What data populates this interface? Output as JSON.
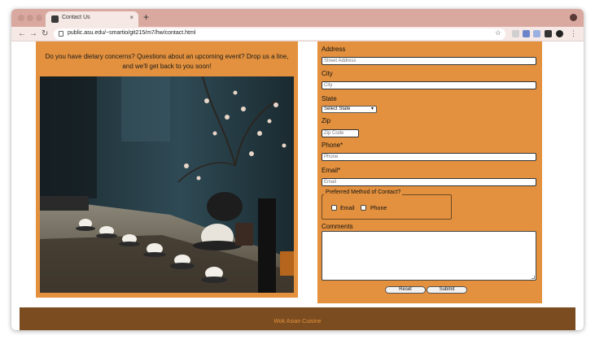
{
  "browser": {
    "tab_title": "Contact Us",
    "new_tab_symbol": "+",
    "tab_close_symbol": "×",
    "url": "public.asu.edu/~smartio/git215/m7/hw/contact.html",
    "nav_back": "←",
    "nav_forward": "→",
    "nav_reload": "↻",
    "bookmark_icon": "star-icon"
  },
  "page": {
    "intro_text": "Do you have dietary concerns? Questions about an upcoming event? Drop us a line, and we'll get back to you soon!",
    "photo_alt": "tea set"
  },
  "form": {
    "address_label": "Address",
    "address_placeholder": "Street Address",
    "city_label": "City",
    "city_placeholder": "City",
    "state_label": "State",
    "state_selected": "Select State",
    "zip_label": "Zip",
    "zip_placeholder": "Zip Code",
    "phone_label": "Phone*",
    "phone_placeholder": "Phone",
    "email_label": "Email*",
    "email_placeholder": "Email",
    "contact_method_legend": "Preferred Method of Contact?",
    "contact_option_email": "Email",
    "contact_option_phone": "Phone",
    "comments_label": "Comments",
    "reset_label": "Reset",
    "submit_label": "Submit"
  },
  "footer": {
    "text": "Wok Asian Cuisine"
  },
  "colors": {
    "panel": "#e3913e",
    "footer": "#7a4c1f",
    "footer_text": "#e3913e",
    "chrome_tabstrip": "#d9a9a0"
  }
}
